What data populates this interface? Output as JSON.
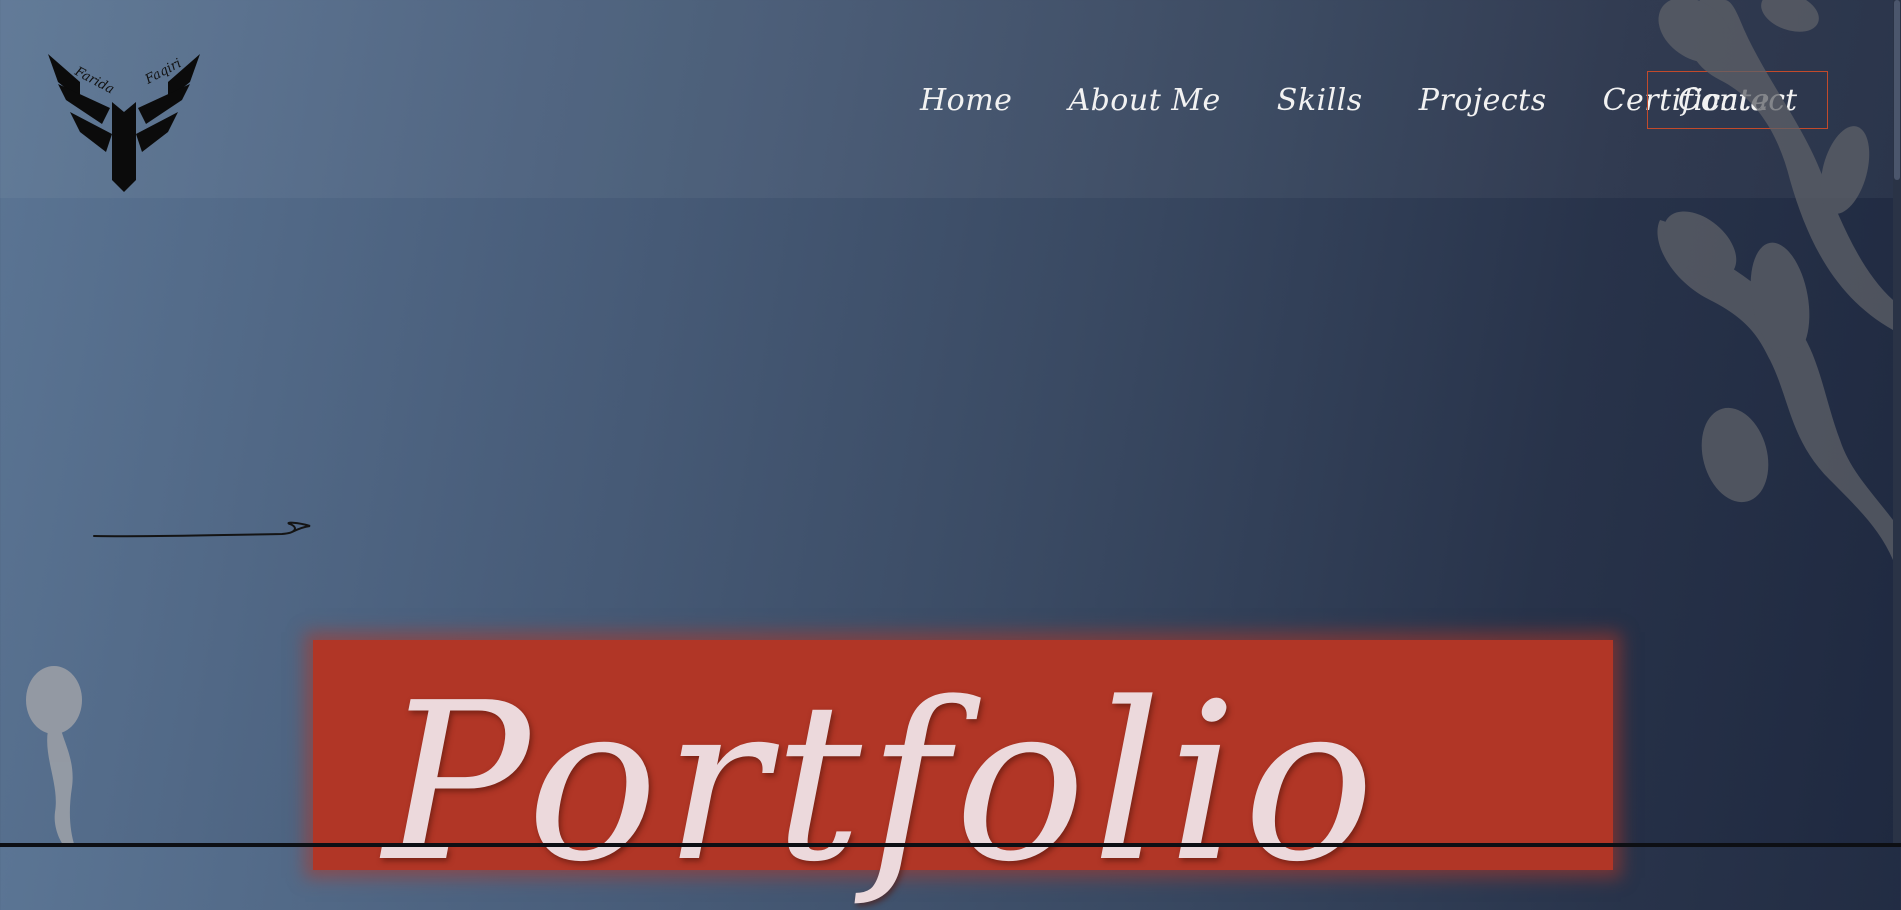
{
  "header": {
    "logo": {
      "text_left": "Farida",
      "text_right": "Faqiri",
      "icon": "winged-monogram-logo"
    }
  },
  "nav": {
    "items": [
      {
        "label": "Home"
      },
      {
        "label": "About Me"
      },
      {
        "label": "Skills"
      },
      {
        "label": "Projects"
      },
      {
        "label": "Certificate"
      }
    ],
    "contact_label": "Contact"
  },
  "hero": {
    "title": "Portfolio",
    "decor_icon": "hand-drawn-arrow-icon"
  },
  "colors": {
    "accent": "#b13626",
    "button_border": "#c24a2b",
    "text": "#f2f2f2",
    "title_text": "#ecd9dc"
  }
}
